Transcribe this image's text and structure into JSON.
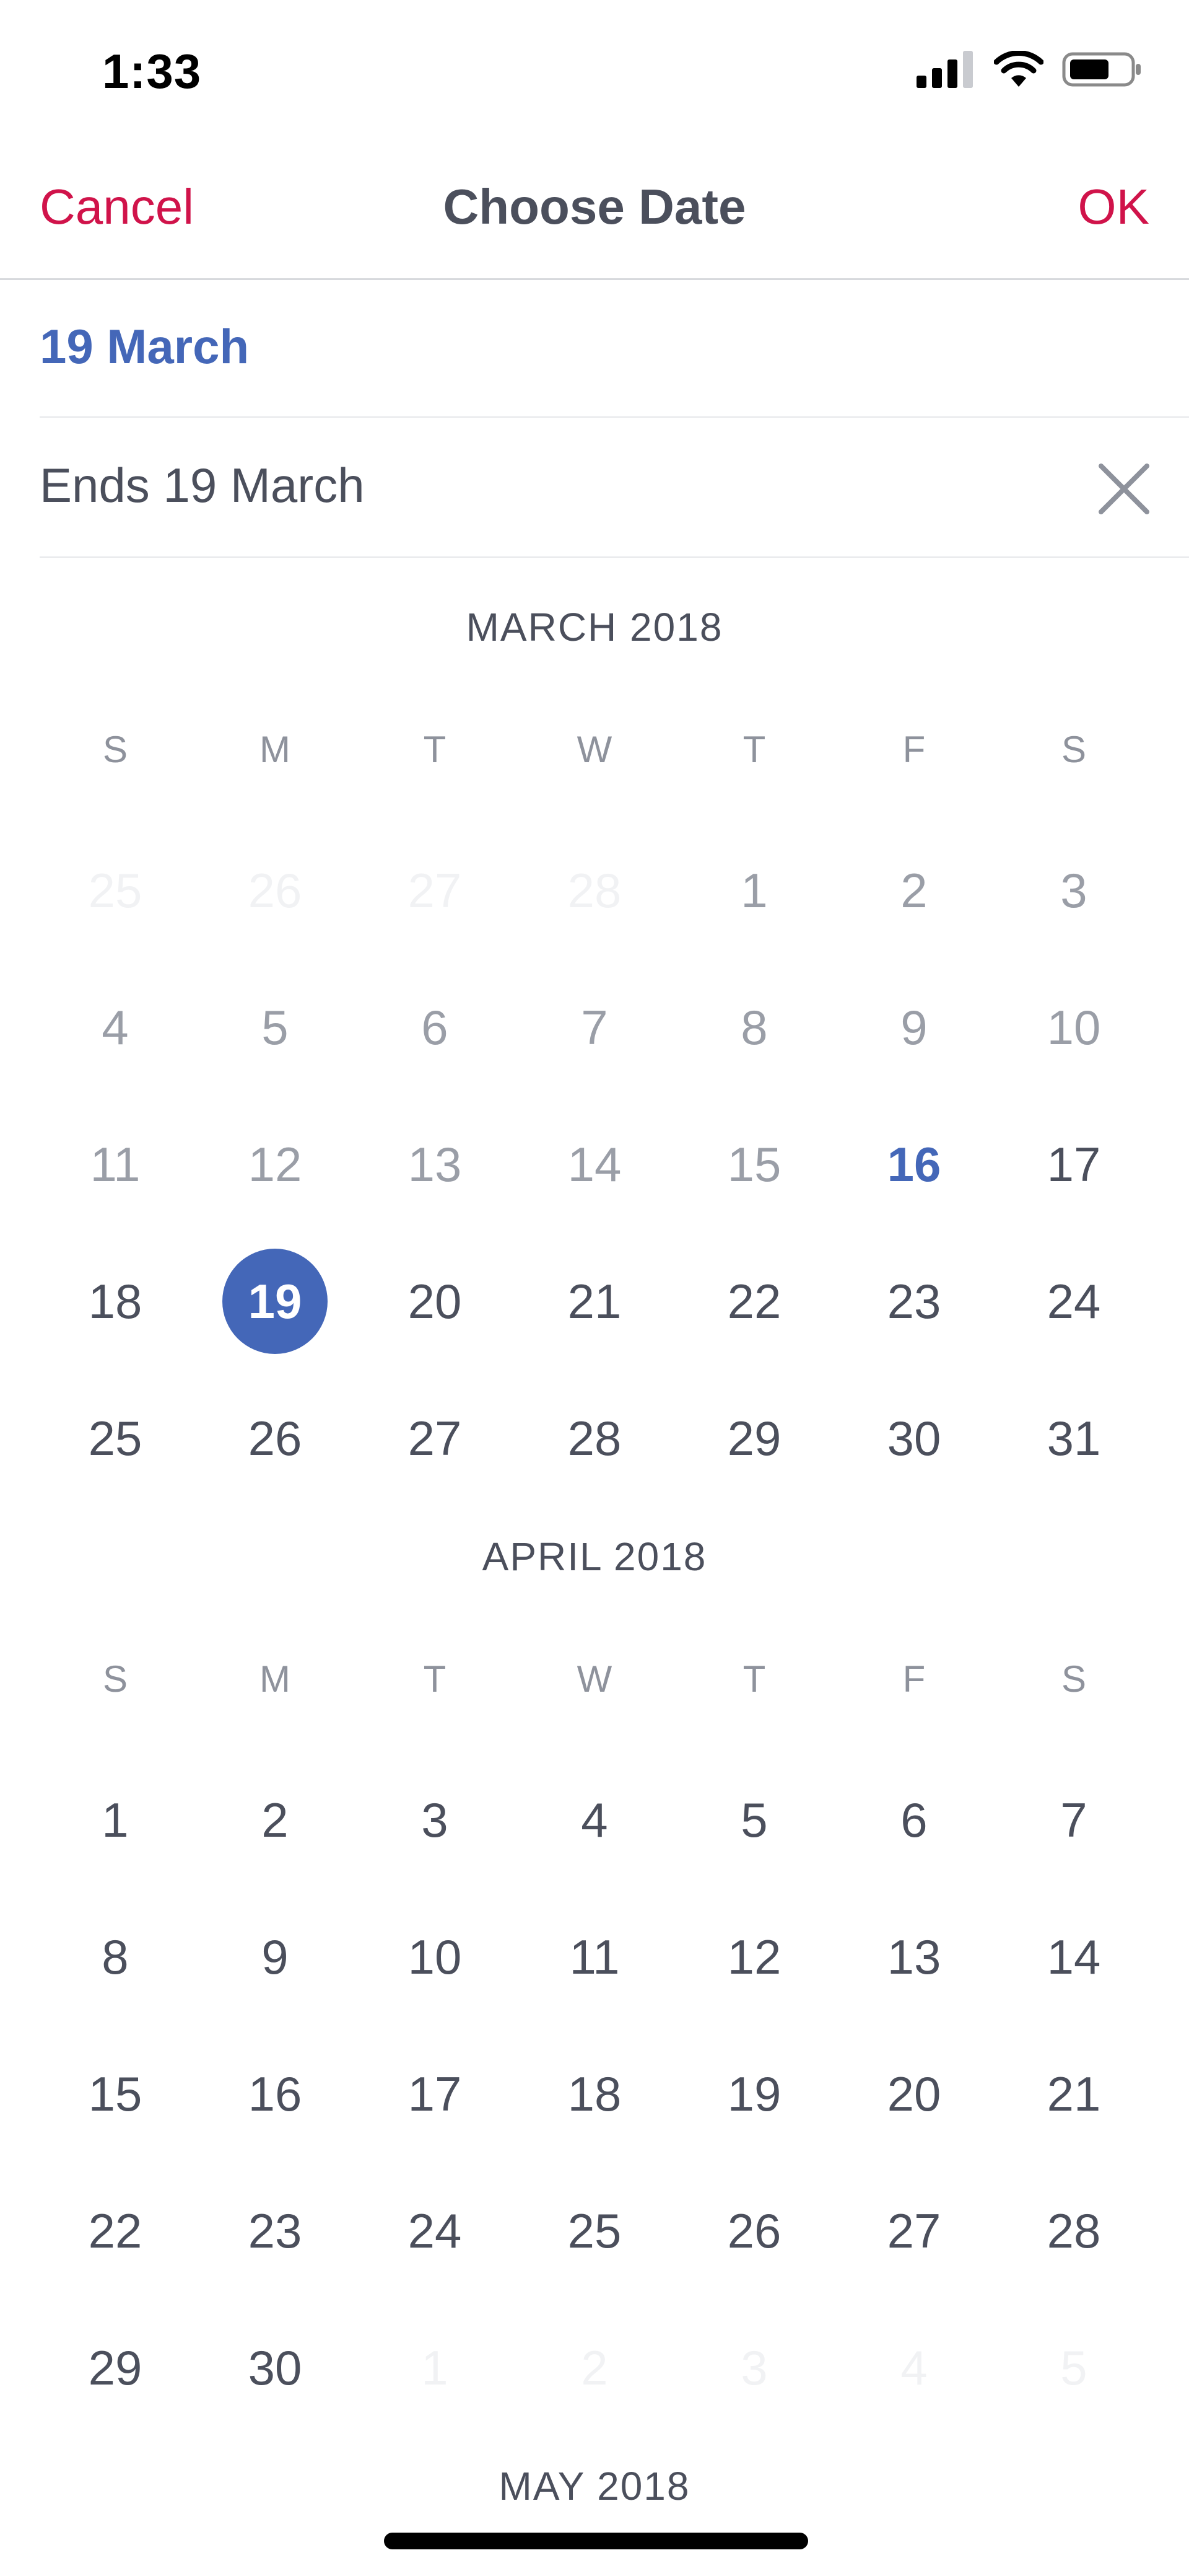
{
  "status_bar": {
    "time": "1:33",
    "icons": [
      "signal-icon",
      "wifi-icon",
      "battery-icon"
    ]
  },
  "header": {
    "cancel_label": "Cancel",
    "title": "Choose Date",
    "ok_label": "OK"
  },
  "start_date": "19 March",
  "end_date": "Ends 19 March",
  "colors": {
    "accent_red": "#d0134a",
    "accent_blue": "#4467b8",
    "text": "#4b4f5c",
    "muted": "#9a9ea7",
    "faint": "#f1f2f4"
  },
  "weekday_headers": [
    "S",
    "M",
    "T",
    "W",
    "T",
    "F",
    "S"
  ],
  "months": [
    {
      "title": "MARCH 2018",
      "weeks": [
        [
          {
            "d": "25",
            "s": "other"
          },
          {
            "d": "26",
            "s": "other"
          },
          {
            "d": "27",
            "s": "other"
          },
          {
            "d": "28",
            "s": "other"
          },
          {
            "d": "1",
            "s": "past"
          },
          {
            "d": "2",
            "s": "past"
          },
          {
            "d": "3",
            "s": "past"
          }
        ],
        [
          {
            "d": "4",
            "s": "past"
          },
          {
            "d": "5",
            "s": "past"
          },
          {
            "d": "6",
            "s": "past"
          },
          {
            "d": "7",
            "s": "past"
          },
          {
            "d": "8",
            "s": "past"
          },
          {
            "d": "9",
            "s": "past"
          },
          {
            "d": "10",
            "s": "past"
          }
        ],
        [
          {
            "d": "11",
            "s": "past"
          },
          {
            "d": "12",
            "s": "past"
          },
          {
            "d": "13",
            "s": "past"
          },
          {
            "d": "14",
            "s": "past"
          },
          {
            "d": "15",
            "s": "past"
          },
          {
            "d": "16",
            "s": "today"
          },
          {
            "d": "17",
            "s": "normal"
          }
        ],
        [
          {
            "d": "18",
            "s": "normal"
          },
          {
            "d": "19",
            "s": "selected"
          },
          {
            "d": "20",
            "s": "normal"
          },
          {
            "d": "21",
            "s": "normal"
          },
          {
            "d": "22",
            "s": "normal"
          },
          {
            "d": "23",
            "s": "normal"
          },
          {
            "d": "24",
            "s": "normal"
          }
        ],
        [
          {
            "d": "25",
            "s": "normal"
          },
          {
            "d": "26",
            "s": "normal"
          },
          {
            "d": "27",
            "s": "normal"
          },
          {
            "d": "28",
            "s": "normal"
          },
          {
            "d": "29",
            "s": "normal"
          },
          {
            "d": "30",
            "s": "normal"
          },
          {
            "d": "31",
            "s": "normal"
          }
        ]
      ]
    },
    {
      "title": "APRIL 2018",
      "weeks": [
        [
          {
            "d": "1",
            "s": "normal"
          },
          {
            "d": "2",
            "s": "normal"
          },
          {
            "d": "3",
            "s": "normal"
          },
          {
            "d": "4",
            "s": "normal"
          },
          {
            "d": "5",
            "s": "normal"
          },
          {
            "d": "6",
            "s": "normal"
          },
          {
            "d": "7",
            "s": "normal"
          }
        ],
        [
          {
            "d": "8",
            "s": "normal"
          },
          {
            "d": "9",
            "s": "normal"
          },
          {
            "d": "10",
            "s": "normal"
          },
          {
            "d": "11",
            "s": "normal"
          },
          {
            "d": "12",
            "s": "normal"
          },
          {
            "d": "13",
            "s": "normal"
          },
          {
            "d": "14",
            "s": "normal"
          }
        ],
        [
          {
            "d": "15",
            "s": "normal"
          },
          {
            "d": "16",
            "s": "normal"
          },
          {
            "d": "17",
            "s": "normal"
          },
          {
            "d": "18",
            "s": "normal"
          },
          {
            "d": "19",
            "s": "normal"
          },
          {
            "d": "20",
            "s": "normal"
          },
          {
            "d": "21",
            "s": "normal"
          }
        ],
        [
          {
            "d": "22",
            "s": "normal"
          },
          {
            "d": "23",
            "s": "normal"
          },
          {
            "d": "24",
            "s": "normal"
          },
          {
            "d": "25",
            "s": "normal"
          },
          {
            "d": "26",
            "s": "normal"
          },
          {
            "d": "27",
            "s": "normal"
          },
          {
            "d": "28",
            "s": "normal"
          }
        ],
        [
          {
            "d": "29",
            "s": "normal"
          },
          {
            "d": "30",
            "s": "normal"
          },
          {
            "d": "1",
            "s": "other"
          },
          {
            "d": "2",
            "s": "other"
          },
          {
            "d": "3",
            "s": "other"
          },
          {
            "d": "4",
            "s": "other"
          },
          {
            "d": "5",
            "s": "other"
          }
        ]
      ]
    },
    {
      "title": "MAY 2018",
      "weeks": []
    }
  ]
}
